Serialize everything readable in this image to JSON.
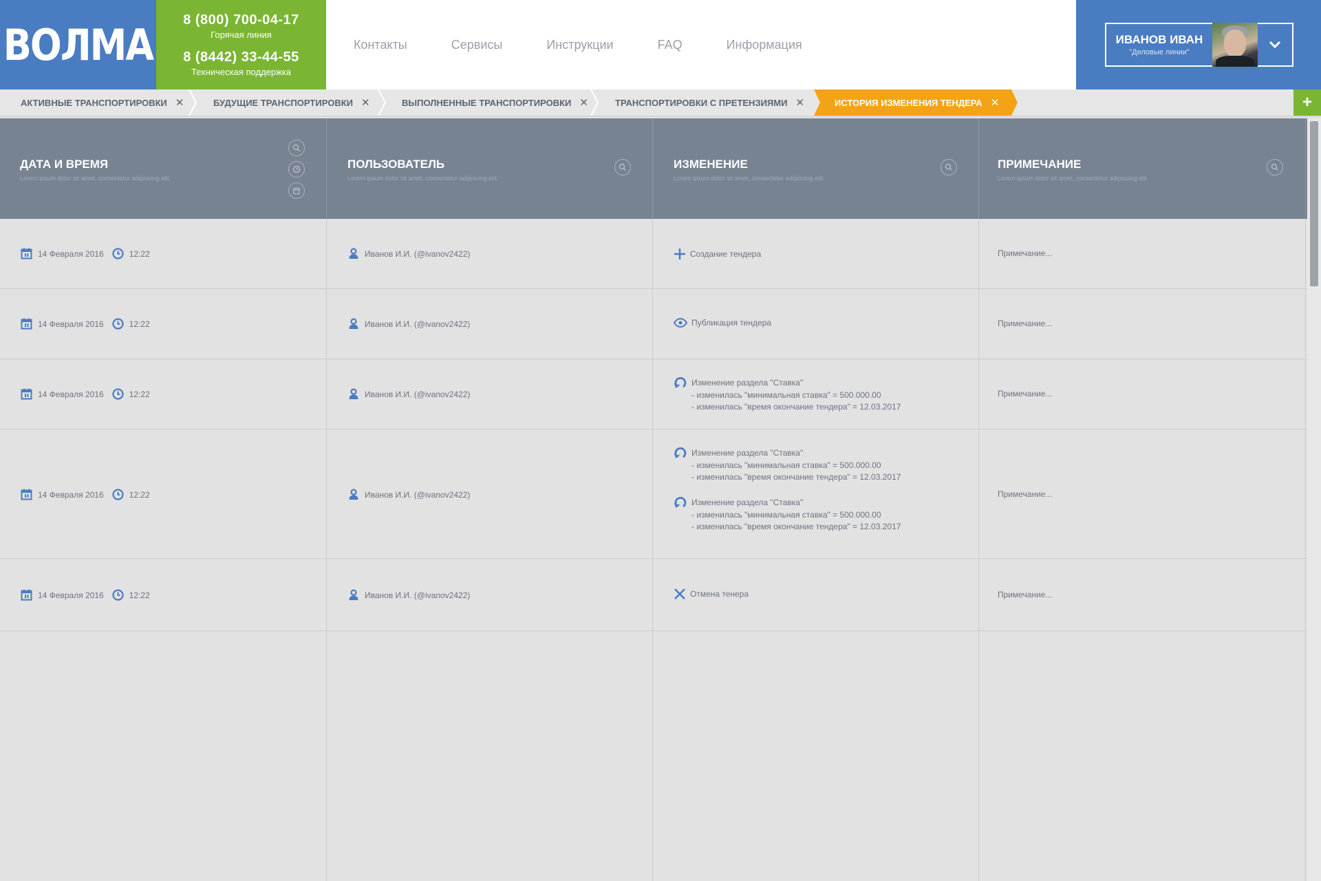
{
  "brand": {
    "logo": "ВОЛМА"
  },
  "contacts": {
    "phone1": "8 (800) 700-04-17",
    "phone1_label": "Горячая линия",
    "phone2": "8 (8442) 33-44-55",
    "phone2_label": "Техническая поддержка"
  },
  "nav": [
    "Контакты",
    "Сервисы",
    "Инструкции",
    "FAQ",
    "Информация"
  ],
  "user": {
    "name": "ИВАНОВ ИВАН",
    "company": "\"Деловые линии\""
  },
  "tabs": [
    {
      "label": "АКТИВНЫЕ ТРАНСПОРТИРОВКИ",
      "active": false
    },
    {
      "label": "БУДУЩИЕ ТРАНСПОРТИРОВКИ",
      "active": false
    },
    {
      "label": "ВЫПОЛНЕННЫЕ ТРАНСПОРТИРОВКИ",
      "active": false
    },
    {
      "label": "ТРАНСПОРТИРОВКИ С ПРЕТЕНЗИЯМИ",
      "active": false
    },
    {
      "label": "ИСТОРИЯ ИЗМЕНЕНИЯ ТЕНДЕРА",
      "active": true
    }
  ],
  "tab_close": "✕",
  "tab_add": "+",
  "columns": [
    {
      "title": "ДАТА И ВРЕМЯ",
      "subtitle": "Lorem ipsum dolor sit amet, consectetur adipiscing elit."
    },
    {
      "title": "ПОЛЬЗОВАТЕЛЬ",
      "subtitle": "Lorem ipsum dolor sit amet, consectetur adipiscing elit."
    },
    {
      "title": "ИЗМЕНЕНИЕ",
      "subtitle": "Lorem ipsum dolor sit amet, consectetur adipiscing elit."
    },
    {
      "title": "ПРИМЕЧАНИЕ",
      "subtitle": "Lorem ipsum dolor sit amet, consectetur adipiscing elit."
    }
  ],
  "rows": [
    {
      "date": "14 Февраля 2016",
      "time": "12:22",
      "user": "Иванов И.И. (@ivanov2422)",
      "change_icon": "plus-icon",
      "change": "Создание тендера",
      "note": "Примечание..."
    },
    {
      "date": "14 Февраля 2016",
      "time": "12:22",
      "user": "Иванов И.И. (@ivanov2422)",
      "change_icon": "eye-icon",
      "change": "Публикация тендера",
      "note": "Примечание..."
    },
    {
      "date": "14 Февраля 2016",
      "time": "12:22",
      "user": "Иванов И.И. (@ivanov2422)",
      "change_icon": "refresh-icon",
      "change": "Изменение раздела \"Ставка\"",
      "details": [
        "- изменилась \"минимальная ставка\" = 500.000.00",
        "- изменилась \"время окончание тендера\" = 12.03.2017"
      ],
      "note": "Примечание..."
    },
    {
      "date": "14 Февраля 2016",
      "time": "12:22",
      "user": "Иванов И.И. (@ivanov2422)",
      "change_icon": "refresh-icon",
      "change": "Изменение раздела \"Ставка\"",
      "details": [
        "- изменилась \"минимальная ставка\" = 500.000.00",
        "- изменилась \"время окончание тендера\" = 12.03.2017"
      ],
      "change2": "Изменение раздела \"Ставка\"",
      "details2": [
        "- изменилась \"минимальная ставка\" = 500.000.00",
        "- изменилась \"время окончание тендера\" = 12.03.2017"
      ],
      "note": "Примечание..."
    },
    {
      "date": "14 Февраля 2016",
      "time": "12:22",
      "user": "Иванов И.И. (@ivanov2422)",
      "change_icon": "close-icon",
      "change": "Отмена тенера",
      "note": "Примечание..."
    }
  ],
  "colors": {
    "blue": "#4a7cc2",
    "green": "#7ab534",
    "orange": "#f5a316",
    "header_gray": "#788392"
  }
}
